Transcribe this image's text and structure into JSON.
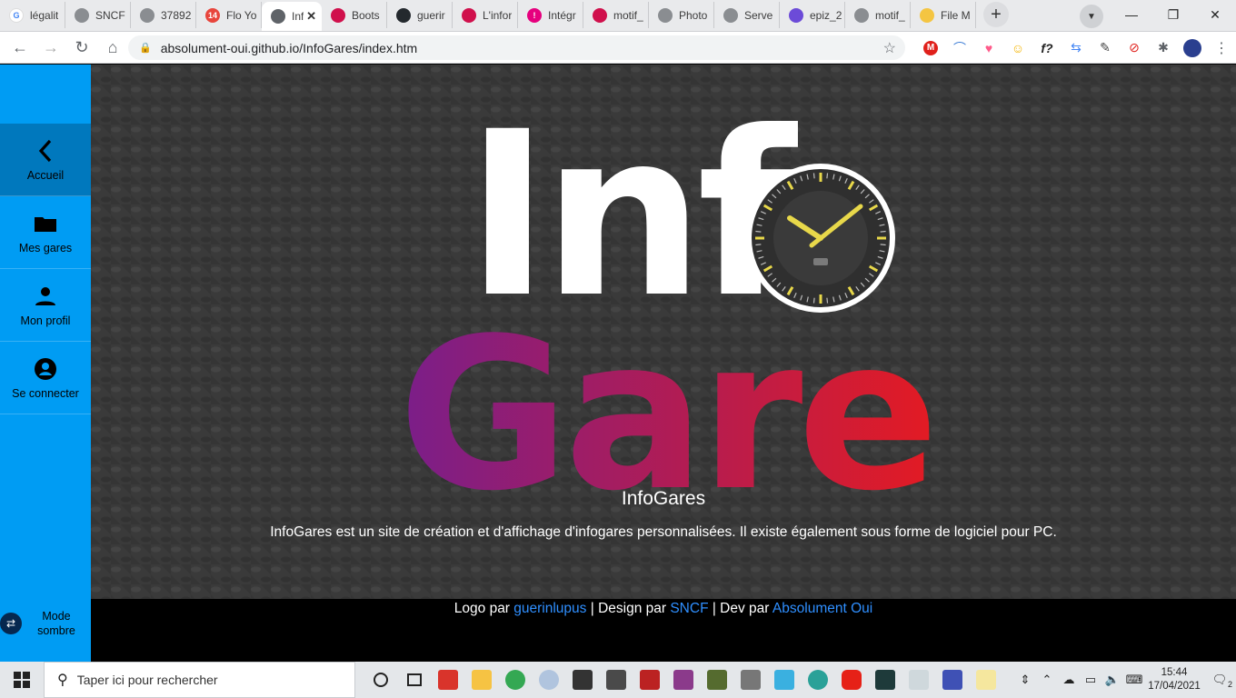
{
  "browser": {
    "tabs": [
      {
        "label": "légalit",
        "fav_color": "#ffffff",
        "fav_text": "G"
      },
      {
        "label": "SNCF",
        "fav_color": "#8a8d91",
        "fav_text": ""
      },
      {
        "label": "37892",
        "fav_color": "#8a8d91",
        "fav_text": ""
      },
      {
        "label": "Flo Yo",
        "fav_color": "#e8453c",
        "fav_text": "14"
      },
      {
        "label": "Inf",
        "fav_color": "#5f6368",
        "fav_text": "",
        "active": true
      },
      {
        "label": "Boots",
        "fav_color": "#d0104c",
        "fav_text": ""
      },
      {
        "label": "guerir",
        "fav_color": "#24292e",
        "fav_text": ""
      },
      {
        "label": "L'infor",
        "fav_color": "#d0104c",
        "fav_text": ""
      },
      {
        "label": "Intégr",
        "fav_color": "#e6007e",
        "fav_text": "!"
      },
      {
        "label": "motif_",
        "fav_color": "#d0104c",
        "fav_text": ""
      },
      {
        "label": "Photo",
        "fav_color": "#8a8d91",
        "fav_text": ""
      },
      {
        "label": "Serve",
        "fav_color": "#8a8d91",
        "fav_text": ""
      },
      {
        "label": "epiz_2",
        "fav_color": "#6c4bd8",
        "fav_text": ""
      },
      {
        "label": "motif_",
        "fav_color": "#8a8d91",
        "fav_text": ""
      },
      {
        "label": "File M",
        "fav_color": "#f4c542",
        "fav_text": ""
      }
    ],
    "new_tab_label": "+",
    "url": "absolument-oui.github.io/InfoGares/index.htm"
  },
  "sidebar": {
    "items": [
      {
        "label": "Accueil",
        "icon": "chevron-left-icon"
      },
      {
        "label": "Mes gares",
        "icon": "folder-icon"
      },
      {
        "label": "Mon profil",
        "icon": "user-icon"
      },
      {
        "label": "Se connecter",
        "icon": "account-circle-icon"
      }
    ],
    "dark_mode_label": "Mode\nsombre"
  },
  "logo": {
    "word1": "Inf",
    "word2": "Gare",
    "colors": {
      "white": "#ffffff",
      "gradient_start": "#7a1e8a",
      "gradient_end": "#e31b23",
      "clock_hands": "#e8d84a"
    }
  },
  "main": {
    "title": "InfoGares",
    "description": "InfoGares est un site de création et d'affichage d'infogares personnalisées. Il existe également sous forme de logiciel pour PC."
  },
  "footer": {
    "logo_prefix": "Logo par ",
    "logo_author": "guerinlupus",
    "design_prefix": " | Design par ",
    "design_author": "SNCF",
    "dev_prefix": " | Dev par ",
    "dev_author": "Absolument Oui"
  },
  "taskbar": {
    "search_placeholder": "Taper ici pour rechercher",
    "time": "15:44",
    "date": "17/04/2021",
    "notifications": "2"
  }
}
